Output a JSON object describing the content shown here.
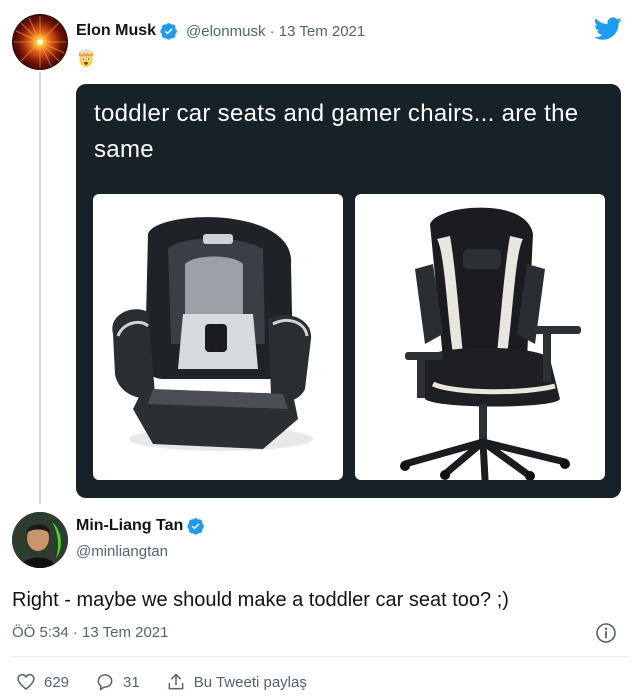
{
  "original_tweet": {
    "author_name": "Elon Musk",
    "handle_and_date": "@elonmusk · 13 Tem 2021",
    "emoji": "exploding-head-emoji",
    "media_caption": "toddler car seats and gamer chairs... are the same",
    "media_left": "toddler-car-seat-photo",
    "media_right": "gamer-chair-photo"
  },
  "reply_tweet": {
    "author_name": "Min-Liang Tan",
    "handle": "@minliangtan",
    "text": "Right - maybe we should make a toddler car seat too? ;)",
    "meta": "ÖÖ 5:34 · 13 Tem 2021",
    "likes": "629",
    "replies": "31",
    "share_label": "Bu Tweeti paylaş"
  },
  "colors": {
    "verified": "#1d9bf0",
    "twitter_blue": "#1d9bf0",
    "media_bg": "#172128",
    "muted_text": "#536471"
  }
}
